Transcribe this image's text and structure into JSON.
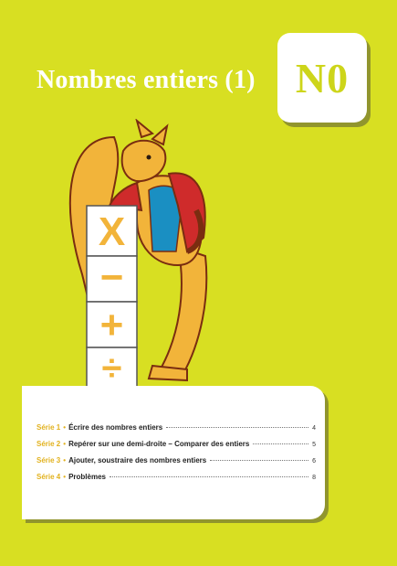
{
  "header": {
    "title": "Nombres entiers (1)",
    "code": "N0"
  },
  "illustration": {
    "blocks": [
      "X",
      "−",
      "+",
      "÷"
    ],
    "colors": {
      "block_sign": "#f2b43a",
      "kangaroo_body": "#f2b43a",
      "jacket": "#cf2b2b",
      "shirt": "#1a8fc2",
      "outline": "#7a2d10"
    }
  },
  "toc": {
    "items": [
      {
        "serie": "Série 1",
        "label": "Écrire des nombres entiers",
        "page": "4"
      },
      {
        "serie": "Série 2",
        "label": "Repérer sur une demi-droite – Comparer des entiers",
        "page": "5"
      },
      {
        "serie": "Série 3",
        "label": "Ajouter, soustraire des nombres entiers",
        "page": "6"
      },
      {
        "serie": "Série 4",
        "label": "Problèmes",
        "page": "8"
      }
    ]
  },
  "colors": {
    "background": "#d8df22",
    "accent": "#e2b21f",
    "code_text": "#cdd51a"
  }
}
